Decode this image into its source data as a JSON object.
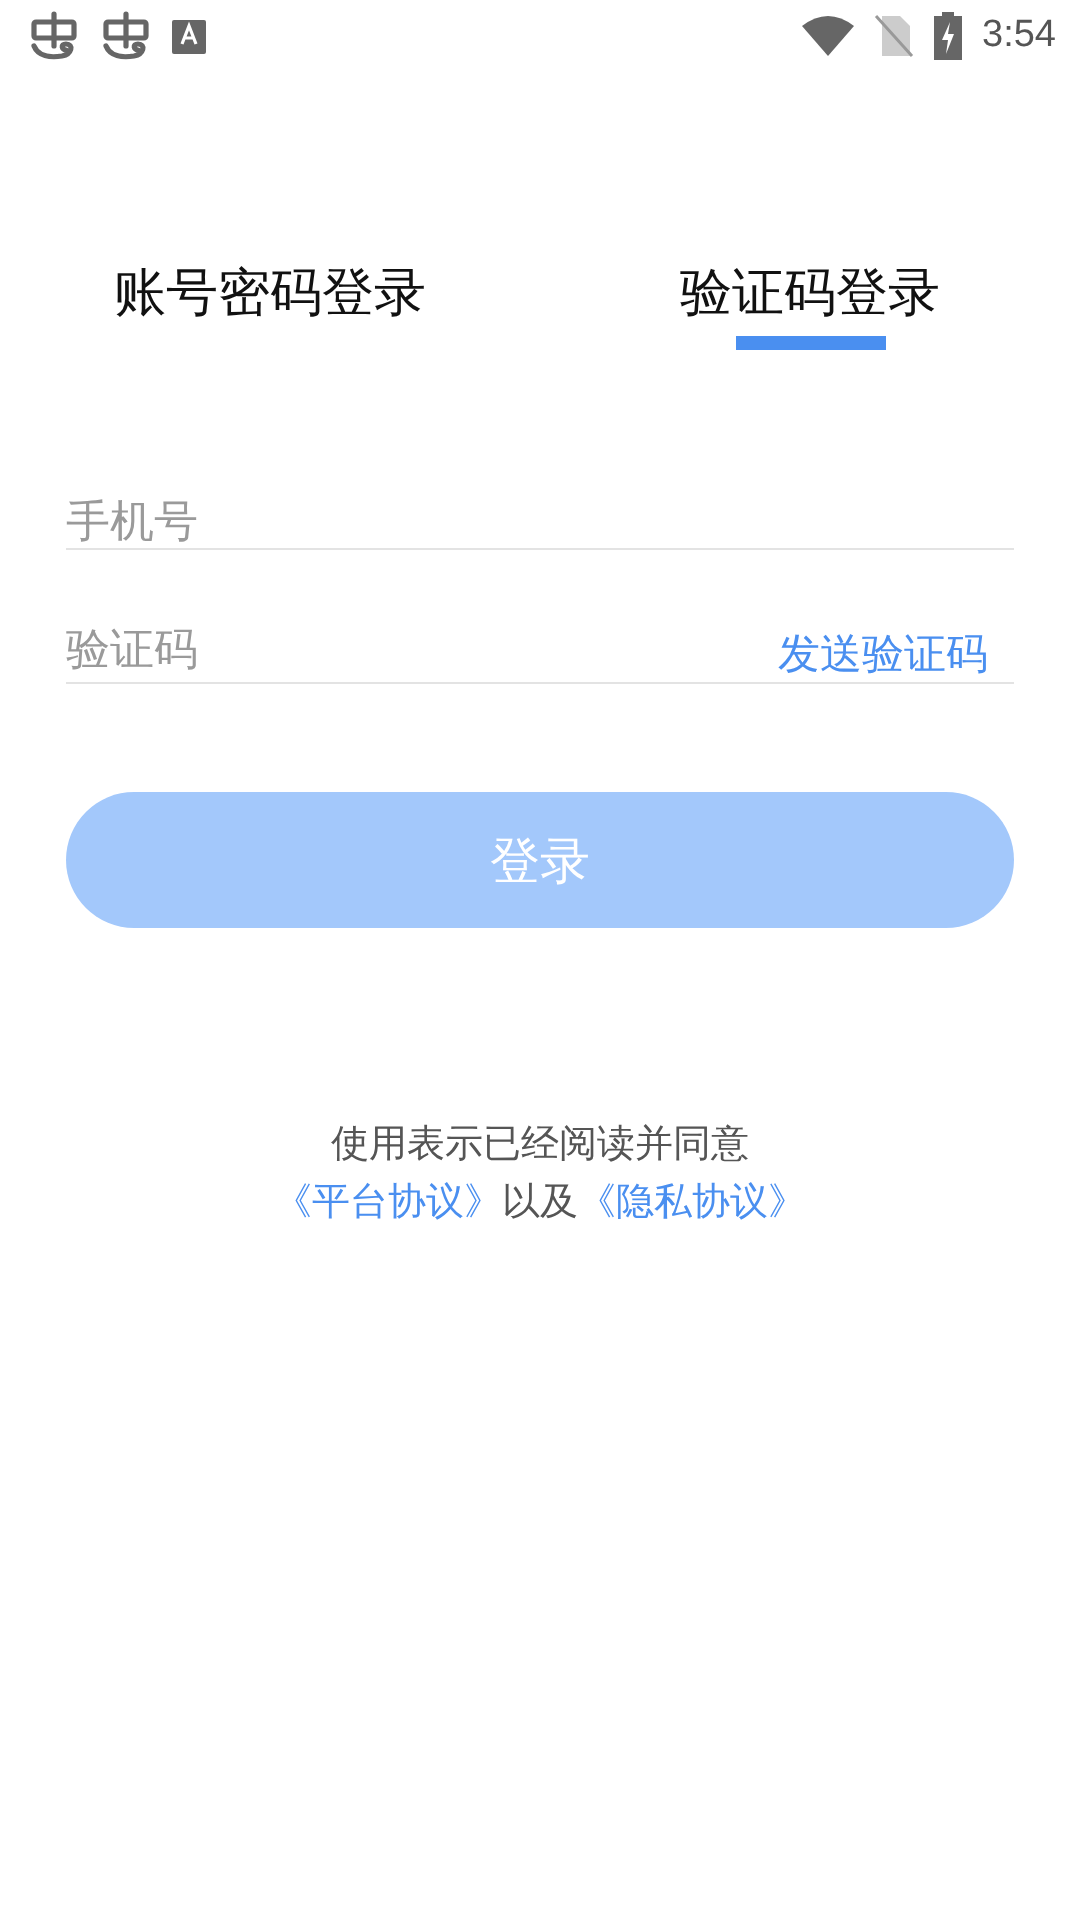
{
  "status_bar": {
    "time": "3:54"
  },
  "tabs": [
    {
      "label": "账号密码登录",
      "selected": false
    },
    {
      "label": "验证码登录",
      "selected": true
    }
  ],
  "fields": [
    {
      "placeholder": "手机号"
    },
    {
      "placeholder": "验证码",
      "action": "发送验证码"
    }
  ],
  "login_button": {
    "label": "登录",
    "disabled": true
  },
  "agreement": {
    "lines": [
      [
        {
          "kind": "text",
          "text": "使用表示已经阅读并同意"
        }
      ],
      [
        {
          "kind": "link",
          "text": "《平台协议》"
        },
        {
          "kind": "text",
          "text": "以及"
        },
        {
          "kind": "link",
          "text": "《隐私协议》"
        }
      ]
    ]
  }
}
